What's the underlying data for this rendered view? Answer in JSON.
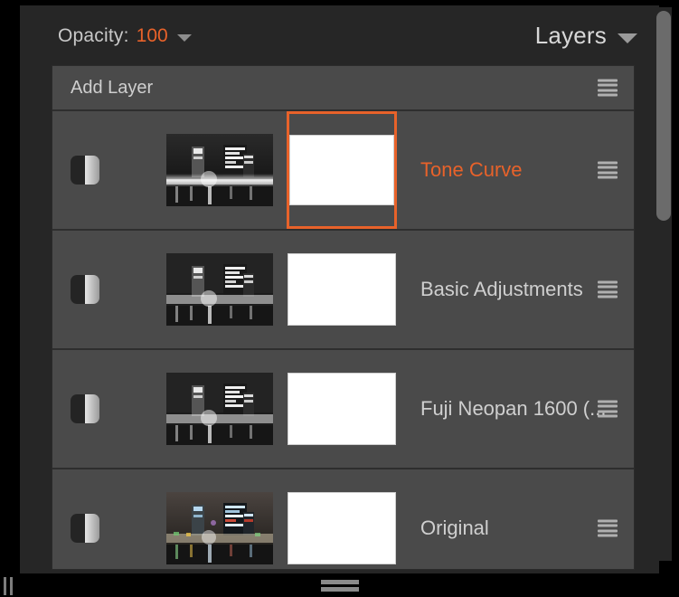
{
  "header": {
    "opacity_label": "Opacity:",
    "opacity_value": "100",
    "opacity_caret_icon": "chevron-down-icon",
    "panel_title": "Layers",
    "panel_caret_icon": "chevron-down-icon"
  },
  "list": {
    "add_layer_label": "Add Layer",
    "add_layer_menu_icon": "hamburger-menu-icon",
    "rows": [
      {
        "name": "Tone Curve",
        "selected": true,
        "thumbnail": "bw-cityscape-night",
        "mask": "white-mask",
        "visibility_icon": "mask-toggle-icon",
        "menu_icon": "hamburger-menu-icon"
      },
      {
        "name": "Basic Adjustments",
        "selected": false,
        "thumbnail": "bw-cityscape-night",
        "mask": "white-mask",
        "visibility_icon": "mask-toggle-icon",
        "menu_icon": "hamburger-menu-icon"
      },
      {
        "name": "Fuji Neopan 1600 (...",
        "selected": false,
        "thumbnail": "bw-cityscape-night",
        "mask": "white-mask",
        "visibility_icon": "mask-toggle-icon",
        "menu_icon": "hamburger-menu-icon"
      },
      {
        "name": "Original",
        "selected": false,
        "thumbnail": "color-cityscape-night",
        "mask": "white-mask",
        "visibility_icon": "mask-toggle-icon",
        "menu_icon": "hamburger-menu-icon"
      }
    ]
  },
  "scrollbar": {
    "name": "vertical-scrollbar",
    "thumb_position": "top"
  },
  "bottom_bar": {
    "grip_icon": "drag-grip-icon",
    "left_grip_icon": "resize-grip-icon"
  },
  "colors": {
    "accent": "#e8622a",
    "panel_bg": "#262626",
    "row_bg": "#4a4a4a",
    "text": "#cfcfcf"
  }
}
